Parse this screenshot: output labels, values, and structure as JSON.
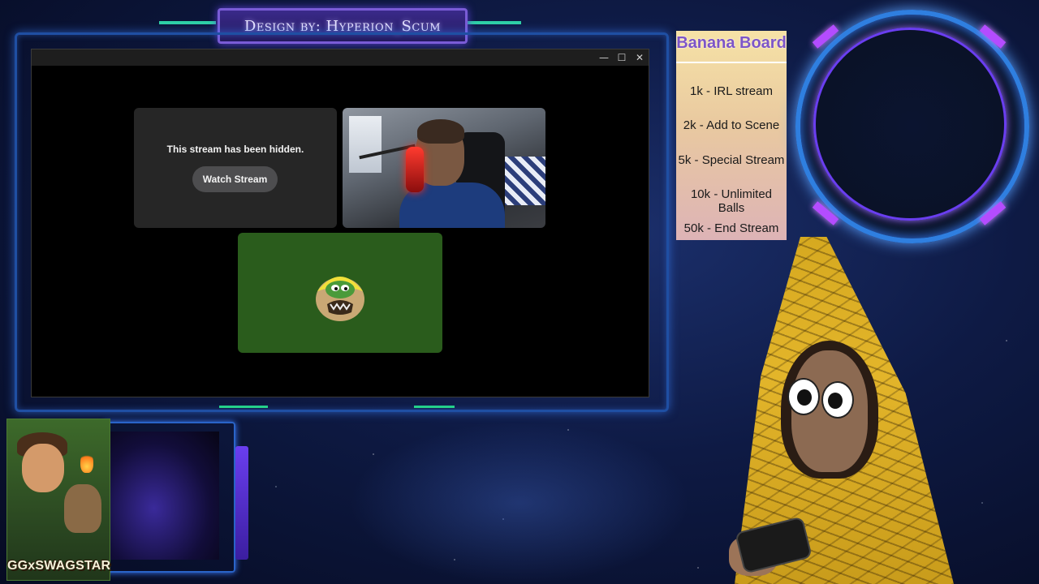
{
  "overlay": {
    "title": "Design by: Hyperion_Scum",
    "logo_text": "GGxSWAGSTAR"
  },
  "window": {
    "controls": {
      "minimize": "—",
      "maximize": "☐",
      "close": "✕"
    }
  },
  "stream_tiles": {
    "hidden": {
      "message": "This stream has been hidden.",
      "button_label": "Watch Stream"
    }
  },
  "banana_board": {
    "title": "Banana Board",
    "items": [
      "1k - IRL stream",
      "2k - Add to Scene",
      "5k - Special Stream",
      "10k - Unlimited Balls",
      "50k - End Stream"
    ]
  },
  "colors": {
    "frame_blue": "#1f4fa3",
    "accent_green": "#25d08a",
    "board_title": "#7d55c8",
    "ring_blue": "#2f7fe0",
    "ring_purple": "#6a3ef0"
  },
  "icons": [
    "minimize-icon",
    "maximize-icon",
    "close-icon",
    "pepe-emote-icon"
  ]
}
